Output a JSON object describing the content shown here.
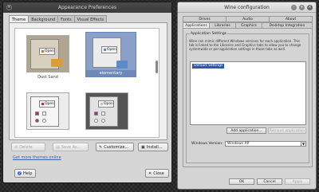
{
  "appearance": {
    "title": "Appearance Preferences",
    "tabs": [
      {
        "label": "Theme"
      },
      {
        "label": "Background"
      },
      {
        "label": "Fonts"
      },
      {
        "label": "Visual Effects"
      }
    ],
    "themes": [
      {
        "name": "Dust Sand",
        "open_label": "Open"
      },
      {
        "name": "elementary",
        "open_label": "Open"
      },
      {
        "name": "",
        "open_label": "Open"
      },
      {
        "name": "",
        "open_label": "Open"
      }
    ],
    "buttons": {
      "delete": "Delete",
      "save_as": "Save As...",
      "customize": "Customize...",
      "install": "Install..."
    },
    "more_themes_link": "Get more themes online",
    "help": "Help",
    "close": "Close"
  },
  "wine": {
    "title": "Wine configuration",
    "tabs_row1": [
      {
        "label": "Drives"
      },
      {
        "label": "Audio"
      },
      {
        "label": "About"
      }
    ],
    "tabs_row2": [
      {
        "label": "Applications"
      },
      {
        "label": "Libraries"
      },
      {
        "label": "Graphics"
      },
      {
        "label": "Desktop Integration"
      }
    ],
    "group_title": "Application Settings",
    "description": "Wine can mimic different Windows versions for each application. This tab is linked to the Libraries and Graphics tabs to allow you to change systemwide or per-application settings in those tabs as well.",
    "list_items": [
      "Default Settings"
    ],
    "add_app": "Add application...",
    "remove_app": "Remove application",
    "windows_version_label": "Windows Version:",
    "windows_version_value": "Windows XP",
    "ok": "OK",
    "cancel": "Cancel",
    "apply": "Apply"
  }
}
